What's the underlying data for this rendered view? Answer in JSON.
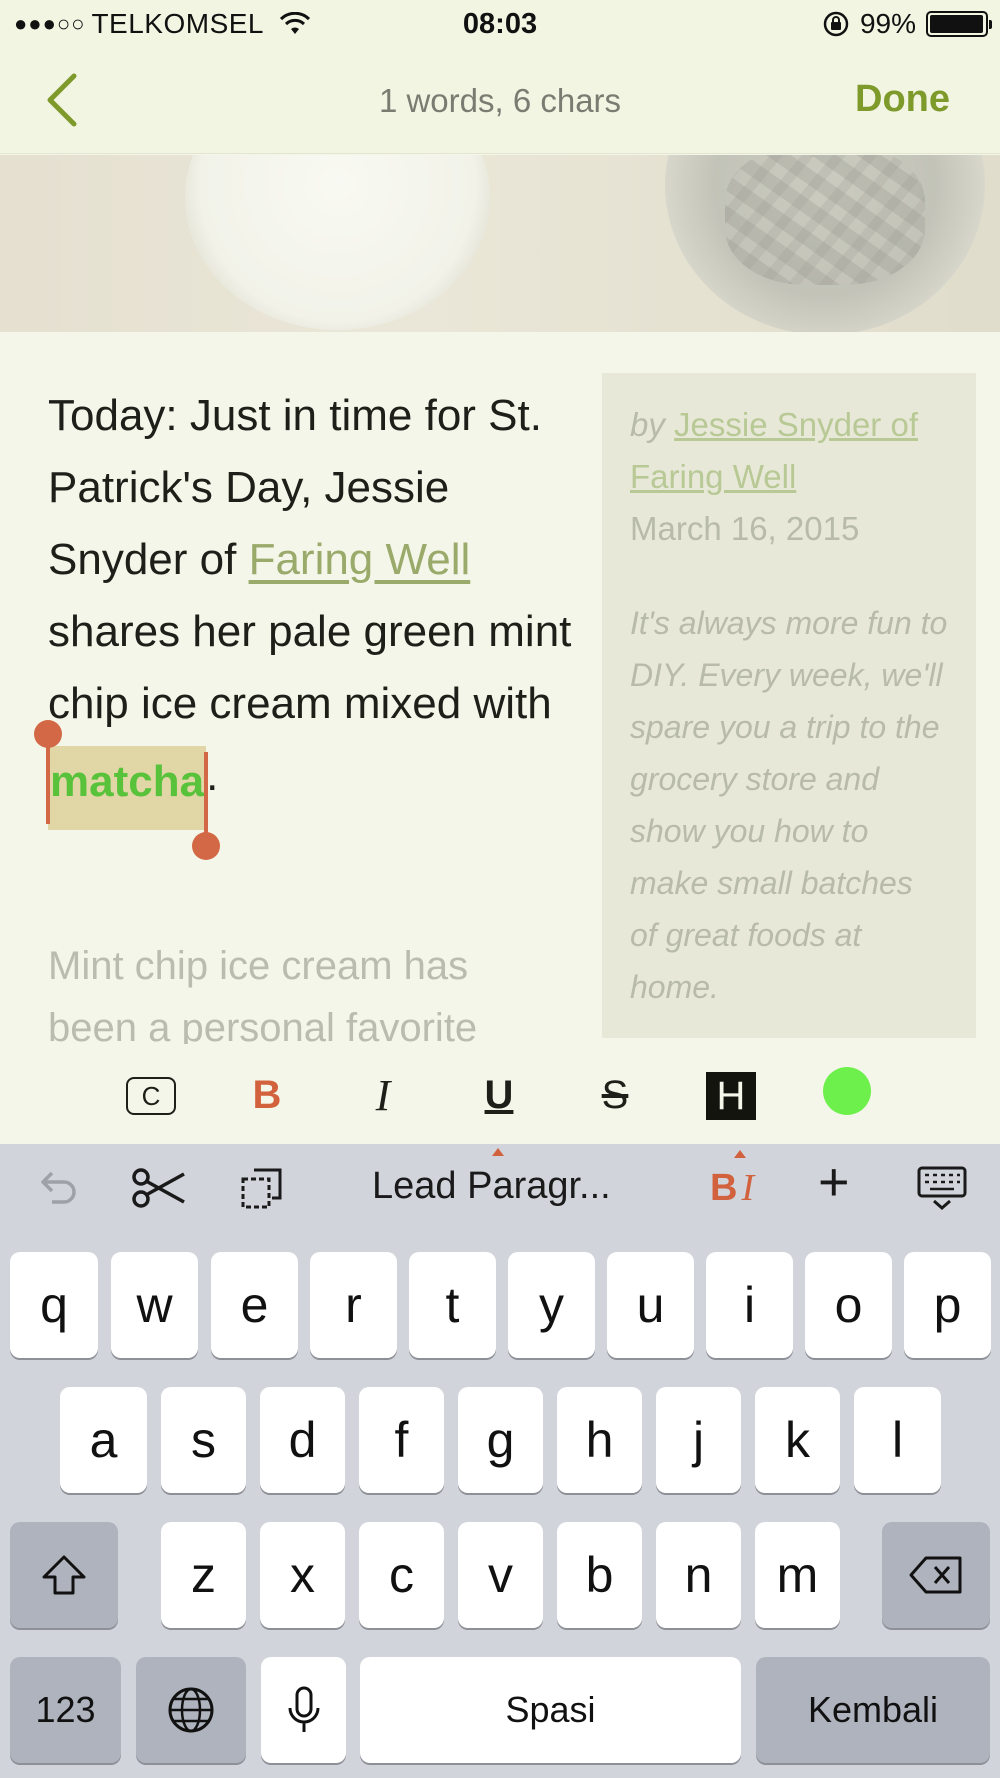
{
  "status_bar": {
    "signal": "●●●○○",
    "carrier": "TELKOMSEL",
    "time": "08:03",
    "battery": "99%",
    "battery_level": 0.99
  },
  "nav": {
    "back_icon": "chevron-left-icon",
    "title": "1 words, 6 chars",
    "done_label": "Done"
  },
  "article": {
    "p1_before_link": "Today: Just in time for St. Patrick's Day, Jessie Snyder of ",
    "link_text": "Faring Well",
    "p1_after_link": " shares her pale green mint chip ice cream mixed with",
    "selected_word": "matcha",
    "p1_end": ".",
    "p2_faded": "Mint chip ice cream has been a personal favorite"
  },
  "sidebar": {
    "by_prefix": "by ",
    "by_link": "Jessie Snyder of Faring Well",
    "date": "March 16, 2015",
    "text": "It's always more fun to DIY. Every week, we'll spare you a trip to the grocery store and show you how to make small batches of great foods at home."
  },
  "format_bar": {
    "code": "C",
    "bold": "B",
    "italic": "I",
    "underline": "U",
    "strike": "S",
    "highlight": "H",
    "color": "#6ef04c",
    "accent": "#d2623d"
  },
  "keyboard_toolbar": {
    "style_label": "Lead Paragr...",
    "bold_label": "B",
    "italic_label": "I",
    "plus_label": "+"
  },
  "keyboard": {
    "row1": [
      "q",
      "w",
      "e",
      "r",
      "t",
      "y",
      "u",
      "i",
      "o",
      "p"
    ],
    "row2": [
      "a",
      "s",
      "d",
      "f",
      "g",
      "h",
      "j",
      "k",
      "l"
    ],
    "row3": [
      "z",
      "x",
      "c",
      "v",
      "b",
      "n",
      "m"
    ],
    "numbers": "123",
    "space": "Spasi",
    "return": "Kembali"
  }
}
